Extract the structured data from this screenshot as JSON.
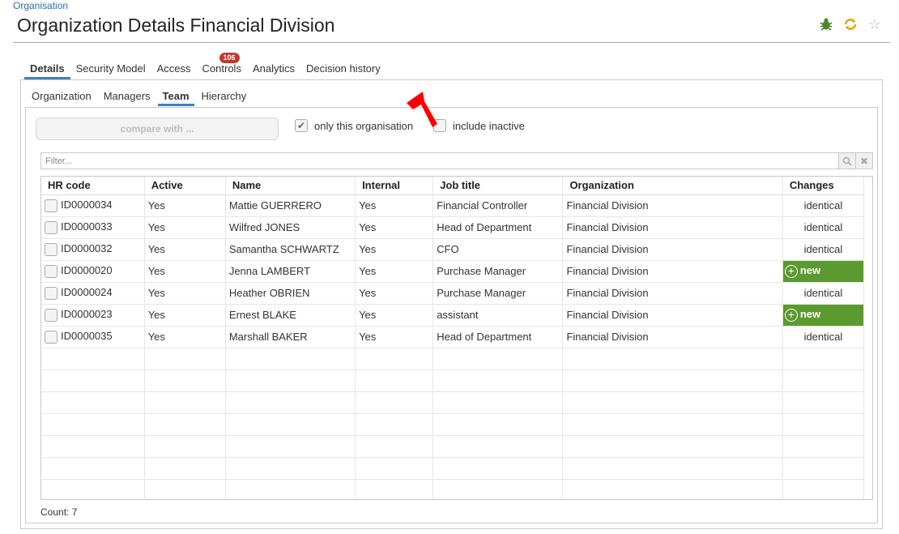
{
  "breadcrumb": "Organisation",
  "title": "Organization Details Financial Division",
  "tabs": [
    {
      "label": "Details",
      "active": true
    },
    {
      "label": "Security Model"
    },
    {
      "label": "Access"
    },
    {
      "label": "Controls",
      "badge": "106"
    },
    {
      "label": "Analytics"
    },
    {
      "label": "Decision history"
    }
  ],
  "subtabs": [
    {
      "label": "Organization"
    },
    {
      "label": "Managers"
    },
    {
      "label": "Team",
      "active": true
    },
    {
      "label": "Hierarchy"
    }
  ],
  "compare_label": "compare with ...",
  "only_this_org": {
    "label": "only this organisation",
    "checked": true
  },
  "include_inactive": {
    "label": "include inactive",
    "checked": false
  },
  "filter_placeholder": "Filter...",
  "columns": [
    "HR code",
    "Active",
    "Name",
    "Internal",
    "Job title",
    "Organization",
    "Changes"
  ],
  "rows": [
    [
      "ID0000034",
      "Yes",
      "Mattie GUERRERO",
      "Yes",
      "Financial Controller",
      "Financial Division",
      "identical"
    ],
    [
      "ID0000033",
      "Yes",
      "Wilfred JONES",
      "Yes",
      "Head of Department",
      "Financial Division",
      "identical"
    ],
    [
      "ID0000032",
      "Yes",
      "Samantha SCHWARTZ",
      "Yes",
      "CFO",
      "Financial Division",
      "identical"
    ],
    [
      "ID0000020",
      "Yes",
      "Jenna LAMBERT",
      "Yes",
      "Purchase Manager",
      "Financial Division",
      "new"
    ],
    [
      "ID0000024",
      "Yes",
      "Heather OBRIEN",
      "Yes",
      "Purchase Manager",
      "Financial Division",
      "identical"
    ],
    [
      "ID0000023",
      "Yes",
      "Ernest BLAKE",
      "Yes",
      "assistant",
      "Financial Division",
      "new"
    ],
    [
      "ID0000035",
      "Yes",
      "Marshall BAKER",
      "Yes",
      "Head of Department",
      "Financial Division",
      "identical"
    ]
  ],
  "count_label": "Count: 7",
  "colors": {
    "accent": "#3b82c4",
    "new_bg": "#5b9a2e",
    "badge": "#c0392b",
    "arrow": "#ff0000"
  },
  "icons": [
    "bug-icon",
    "sync-icon",
    "star-icon",
    "search-icon",
    "clear-icon",
    "check-icon",
    "plus-circle-icon"
  ]
}
